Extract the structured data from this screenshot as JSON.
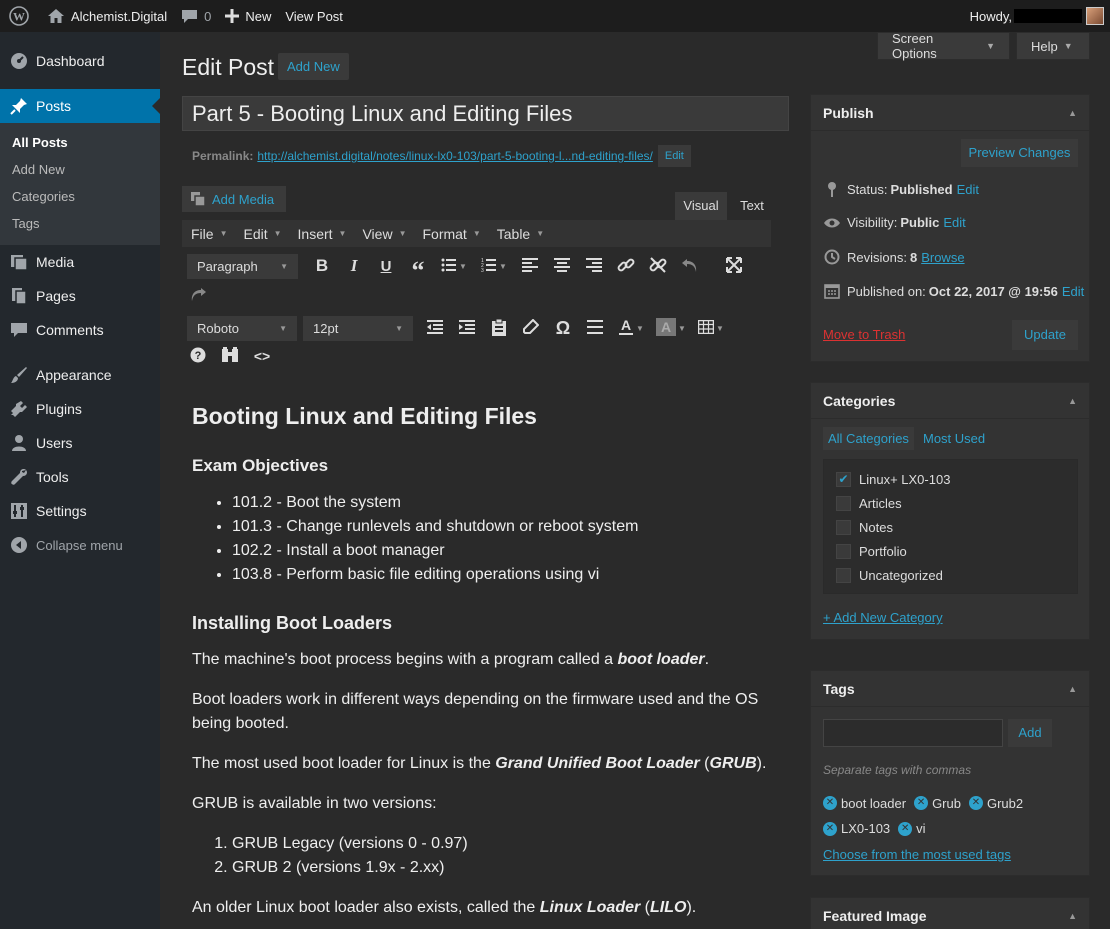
{
  "adminbar": {
    "site_name": "Alchemist.Digital",
    "comments_count": "0",
    "new_label": "New",
    "view_post_label": "View Post",
    "howdy": "Howdy,"
  },
  "sidebar": {
    "dashboard": "Dashboard",
    "posts": "Posts",
    "submenu": [
      "All Posts",
      "Add New",
      "Categories",
      "Tags"
    ],
    "media": "Media",
    "pages": "Pages",
    "comments": "Comments",
    "appearance": "Appearance",
    "plugins": "Plugins",
    "users": "Users",
    "tools": "Tools",
    "settings": "Settings",
    "collapse": "Collapse menu"
  },
  "header": {
    "screen_options": "Screen Options",
    "help": "Help",
    "title": "Edit Post",
    "add_new": "Add New"
  },
  "post": {
    "title": "Part 5 - Booting Linux and Editing Files",
    "permalink_label": "Permalink:",
    "permalink_url": "http://alchemist.digital/notes/linux-lx0-103/part-5-booting-l...nd-editing-files/",
    "permalink_edit": "Edit"
  },
  "editor": {
    "add_media": "Add Media",
    "tab_visual": "Visual",
    "tab_text": "Text",
    "menus": [
      "File",
      "Edit",
      "Insert",
      "View",
      "Format",
      "Table"
    ],
    "paragraph_select": "Paragraph",
    "font_select": "Roboto",
    "size_select": "12pt"
  },
  "content": {
    "heading": "Booting Linux and Editing Files",
    "objectives_heading": "Exam Objectives",
    "objectives": [
      "101.2 - Boot the system",
      "101.3 - Change runlevels and shutdown or reboot system",
      "102.2 - Install a boot manager",
      "103.8 - Perform basic file editing operations using vi"
    ],
    "loaders_heading": "Installing Boot Loaders",
    "p1_pre": "The machine's boot process begins with a program called a ",
    "p1_em": "boot loader",
    "p1_post": ".",
    "p2": "Boot loaders work in different ways depending on the firmware used and the OS being booted.",
    "p3_pre": "The most used boot loader for Linux is the ",
    "p3_em": "Grand Unified Boot Loader",
    "p3_mid": " (",
    "p3_em2": "GRUB",
    "p3_post": ").",
    "p4": "GRUB is available in two versions:",
    "grub_versions": [
      "GRUB Legacy (versions 0 - 0.97)",
      "GRUB 2 (versions 1.9x - 2.xx)"
    ],
    "p5_pre": "An older Linux boot loader also exists, called the ",
    "p5_em": "Linux Loader",
    "p5_mid": " (",
    "p5_em2": "LILO",
    "p5_post": ")."
  },
  "publish": {
    "title": "Publish",
    "preview": "Preview Changes",
    "status_label": "Status:",
    "status_value": "Published",
    "visibility_label": "Visibility:",
    "visibility_value": "Public",
    "revisions_label": "Revisions:",
    "revisions_value": "8",
    "browse": "Browse",
    "published_label": "Published on:",
    "published_value": "Oct 22, 2017 @ 19:56",
    "edit": "Edit",
    "trash": "Move to Trash",
    "update": "Update"
  },
  "categories": {
    "title": "Categories",
    "tab_all": "All Categories",
    "tab_used": "Most Used",
    "items": [
      {
        "label": "Linux+ LX0-103",
        "checked": true
      },
      {
        "label": "Articles",
        "checked": false
      },
      {
        "label": "Notes",
        "checked": false
      },
      {
        "label": "Portfolio",
        "checked": false
      },
      {
        "label": "Uncategorized",
        "checked": false
      }
    ],
    "add_new": "+ Add New Category"
  },
  "tags": {
    "title": "Tags",
    "input_value": "",
    "add": "Add",
    "hint": "Separate tags with commas",
    "items": [
      "boot loader",
      "Grub",
      "Grub2",
      "LX0-103",
      "vi"
    ],
    "choose": "Choose from the most used tags"
  },
  "featured": {
    "title": "Featured Image"
  },
  "colors": {
    "accent": "#0073aa",
    "link": "#2ea2cc",
    "trash": "#dc3232"
  }
}
